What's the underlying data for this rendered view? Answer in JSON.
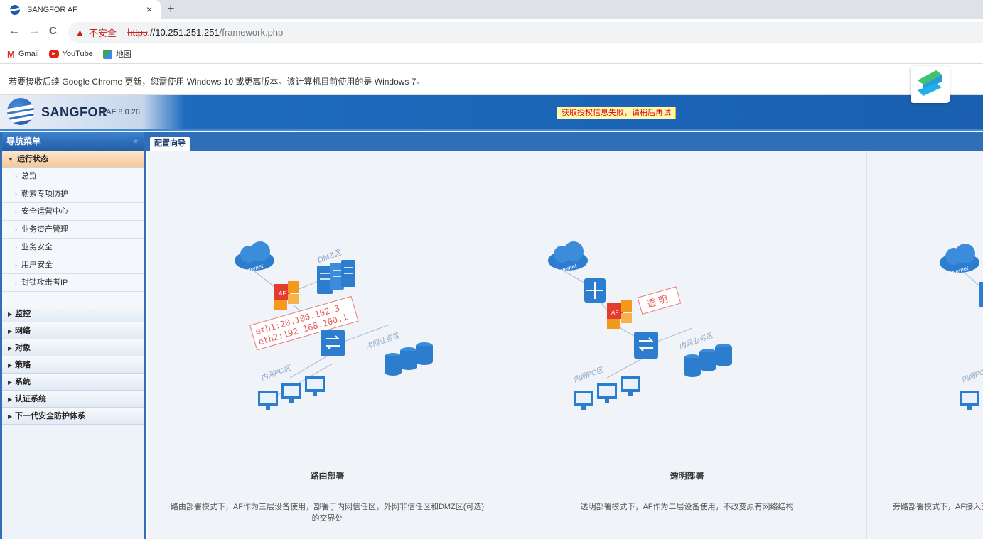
{
  "browser": {
    "tab_title": "SANGFOR AF",
    "close_label": "×",
    "newtab_label": "+",
    "nav": {
      "back": "←",
      "forward": "→",
      "reload": "C"
    },
    "address": {
      "warning_icon": "▲",
      "not_secure": "不安全",
      "separator": "|",
      "protocol": "https",
      "host": "://10.251.251.251",
      "path": "/framework.php"
    },
    "bookmarks": [
      {
        "icon": "gmail-icon",
        "label": "Gmail"
      },
      {
        "icon": "youtube-icon",
        "label": "YouTube"
      },
      {
        "icon": "maps-icon",
        "label": "地图"
      }
    ],
    "infobar_message": "若要接收后续 Google Chrome 更新，您需使用 Windows 10 或更高版本。该计算机目前使用的是 Windows 7。"
  },
  "app": {
    "brand": "SANGFOR",
    "version": "| AF 8.0.26",
    "alert": "获取授权信息失败，请稍后再试"
  },
  "nav": {
    "title": "导航菜单",
    "collapse": "«",
    "open_group": "运行状态",
    "open_items": [
      "总览",
      "勒索专项防护",
      "安全运营中心",
      "业务资产管理",
      "业务安全",
      "用户安全",
      "封锁攻击者IP"
    ],
    "groups": [
      "监控",
      "网络",
      "对象",
      "策略",
      "系统",
      "认证系统",
      "下一代安全防护体系"
    ]
  },
  "main": {
    "tab": "配置向导",
    "cards": [
      {
        "title": "路由部署",
        "desc": "路由部署模式下，AF作为三层设备使用，部署于内网信任区，外网非信任区和DMZ区(可选)的交界处",
        "labels": {
          "internet": "Internet",
          "dmz": "DMZ区",
          "eth1": "eth1:20.100.102.3",
          "eth2": "eth2:192.168.100.1",
          "biz": "内网业务区",
          "pc": "内网PC区",
          "af": "AF"
        }
      },
      {
        "title": "透明部署",
        "desc": "透明部署模式下，AF作为二层设备使用，不改变原有网络结构",
        "labels": {
          "internet": "Internet",
          "transparent": "透 明",
          "biz": "内网业务区",
          "pc": "内网PC区",
          "af": "AF"
        }
      },
      {
        "title": "",
        "desc": "旁路部署模式下，AF接入交",
        "labels": {
          "internet": "Internet",
          "pc": "内网PC"
        }
      }
    ]
  },
  "colors": {
    "accent": "#2e6fb8",
    "alert_bg": "#fff9b0",
    "alert_text": "#dd0000",
    "af_red": "#e33d2f",
    "af_orange": "#f39a1b",
    "icon_blue": "#2d7dcf"
  }
}
